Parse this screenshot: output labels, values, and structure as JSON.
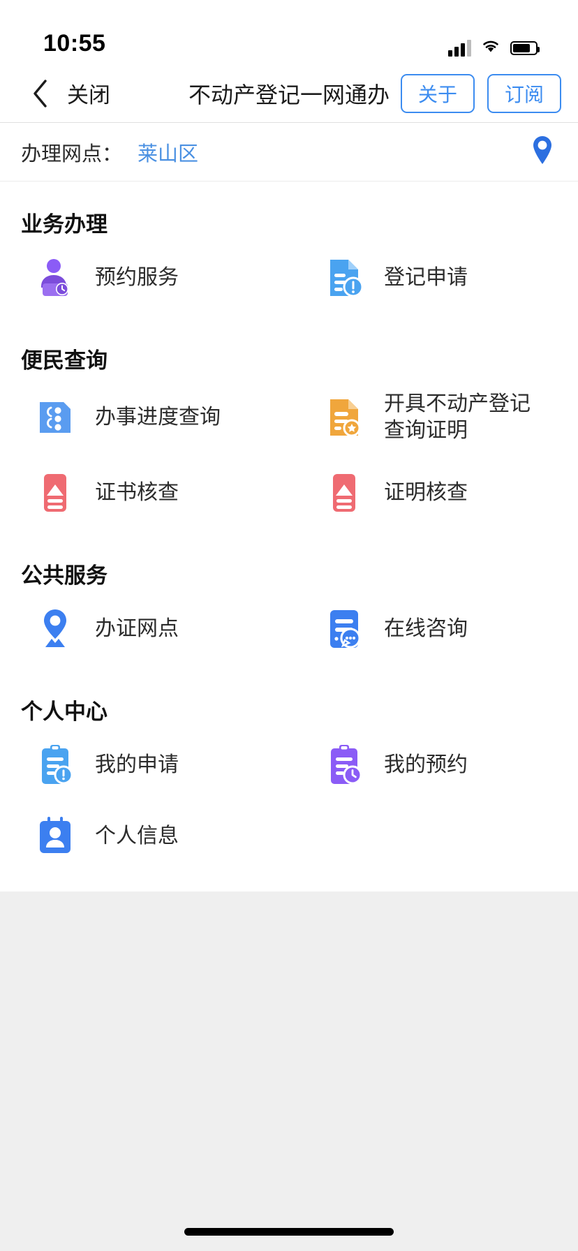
{
  "status_bar": {
    "time": "10:55",
    "signal_icon": "cellular-signal-icon",
    "wifi_icon": "wifi-icon",
    "battery_icon": "battery-icon"
  },
  "nav": {
    "back_icon": "chevron-left-icon",
    "close_label": "关闭",
    "title": "不动产登记一网通办",
    "about_label": "关于",
    "subscribe_label": "订阅",
    "accent_color": "#3c8cf0"
  },
  "location": {
    "label": "办理网点：",
    "value": "莱山区",
    "pin_icon": "location-pin-icon",
    "value_color": "#4a90e2"
  },
  "sections": [
    {
      "title": "业务办理",
      "items": [
        {
          "label": "预约服务",
          "icon": "appointment-person-clock-icon",
          "color": "#8b5cf6"
        },
        {
          "label": "登记申请",
          "icon": "registration-document-icon",
          "color": "#4aa3f0"
        }
      ]
    },
    {
      "title": "便民查询",
      "items": [
        {
          "label": "办事进度查询",
          "icon": "progress-query-card-icon",
          "color": "#5a9cf0"
        },
        {
          "label": "开具不动产登记查询证明",
          "label_line1": "开具不动产登记",
          "label_line2": "查询证明",
          "icon": "certificate-star-document-icon",
          "color": "#f0a63c"
        },
        {
          "label": "证书核查",
          "icon": "certificate-verify-icon",
          "color": "#ef6b72"
        },
        {
          "label": "证明核查",
          "icon": "proof-verify-icon",
          "color": "#ef6b72"
        }
      ]
    },
    {
      "title": "公共服务",
      "items": [
        {
          "label": "办证网点",
          "icon": "service-location-pin-icon",
          "color": "#3c7ff0"
        },
        {
          "label": "在线咨询",
          "icon": "online-consult-chat-icon",
          "color": "#3c7ff0"
        }
      ]
    },
    {
      "title": "个人中心",
      "items": [
        {
          "label": "我的申请",
          "icon": "my-application-clipboard-icon",
          "color": "#4aa3f0"
        },
        {
          "label": "我的预约",
          "icon": "my-appointment-clipboard-clock-icon",
          "color": "#8b5cf6"
        },
        {
          "label": "个人信息",
          "icon": "personal-info-badge-icon",
          "color": "#3c7ff0"
        }
      ]
    }
  ],
  "home_indicator": "home-indicator-bar"
}
